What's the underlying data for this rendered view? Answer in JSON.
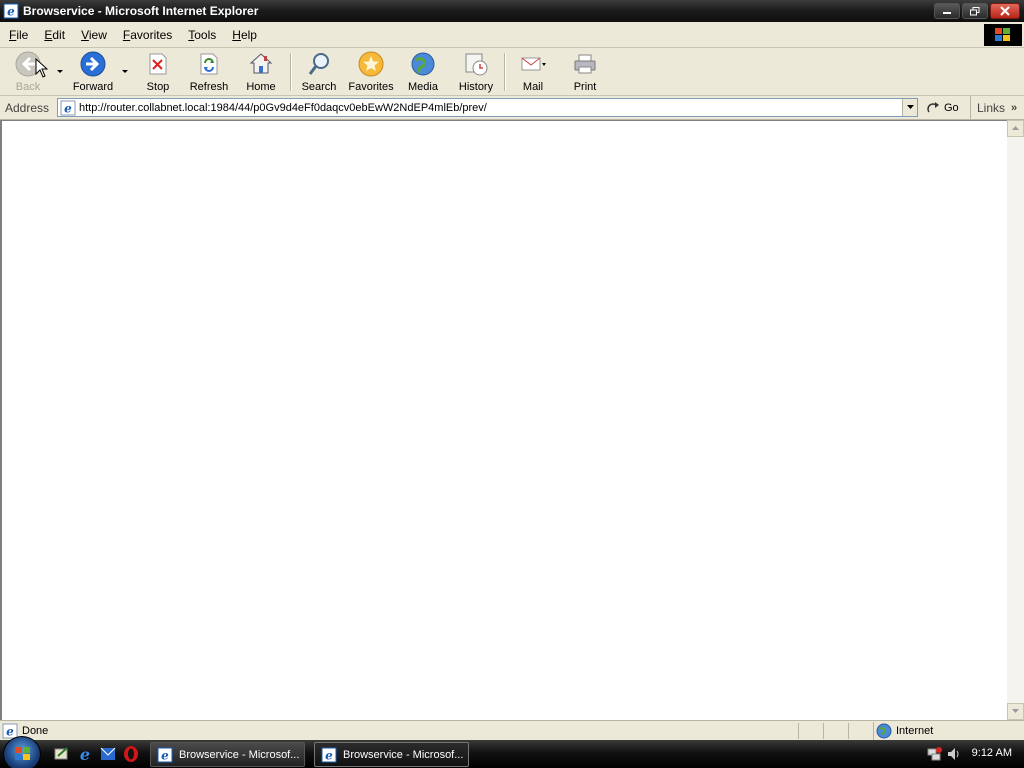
{
  "window": {
    "title": "Browservice - Microsoft Internet Explorer"
  },
  "menu": {
    "items": [
      {
        "accel": "F",
        "rest": "ile"
      },
      {
        "accel": "E",
        "rest": "dit"
      },
      {
        "accel": "V",
        "rest": "iew"
      },
      {
        "accel": "F",
        "rest": "avorites"
      },
      {
        "accel": "T",
        "rest": "ools"
      },
      {
        "accel": "H",
        "rest": "elp"
      }
    ]
  },
  "toolbar": {
    "back": "Back",
    "forward": "Forward",
    "stop": "Stop",
    "refresh": "Refresh",
    "home": "Home",
    "search": "Search",
    "favorites": "Favorites",
    "media": "Media",
    "history": "History",
    "mail": "Mail",
    "print": "Print"
  },
  "address": {
    "label": "Address",
    "url": "http://router.collabnet.local:1984/44/p0Gv9d4eFf0daqcv0ebEwW2NdEP4mlEb/prev/",
    "go": "Go",
    "links": "Links"
  },
  "status": {
    "text": "Done",
    "zone": "Internet"
  },
  "taskbar": {
    "tasks": [
      {
        "label": "Browservice - Microsof..."
      },
      {
        "label": "Browservice - Microsof..."
      }
    ],
    "clock": "9:12 AM"
  },
  "colors": {
    "chrome": "#ece9d8",
    "title_bar": "#1a1a1a",
    "close_button": "#c83a2c",
    "content_bg": "#ffffff"
  }
}
